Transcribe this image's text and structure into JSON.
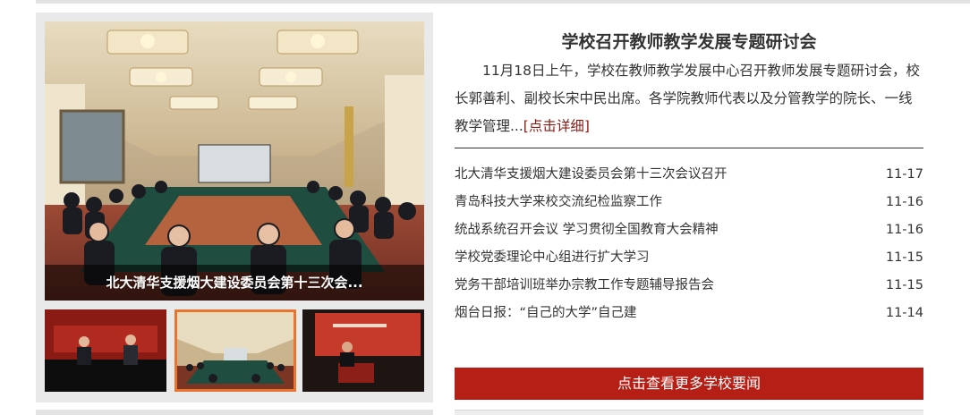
{
  "featured": {
    "caption": "北大清华支援烟大建设委员会第十三次会..."
  },
  "thumbnails": [
    {
      "name": "thumbnail-1",
      "active": false
    },
    {
      "name": "thumbnail-2",
      "active": true
    },
    {
      "name": "thumbnail-3",
      "active": false
    }
  ],
  "headline": {
    "title": "学校召开教师教学发展专题研讨会",
    "summary": "11月18日上午，学校在教师教学发展中心召开教师发展专题研讨会，校长郭善利、副校长宋中民出席。各学院教师代表以及分管教学的院长、一线教学管理...",
    "more_link": "[点击详细]"
  },
  "news": [
    {
      "title": "北大清华支援烟大建设委员会第十三次会议召开",
      "date": "11-17"
    },
    {
      "title": "青岛科技大学来校交流纪检监察工作",
      "date": "11-16"
    },
    {
      "title": "统战系统召开会议 学习贯彻全国教育大会精神",
      "date": "11-16"
    },
    {
      "title": "学校党委理论中心组进行扩大学习",
      "date": "11-15"
    },
    {
      "title": "党务干部培训班举办宗教工作专题辅导报告会",
      "date": "11-15"
    },
    {
      "title": "烟台日报：“自己的大学”自己建",
      "date": "11-14"
    }
  ],
  "more_button": "点击查看更多学校要闻",
  "colors": {
    "accent": "#b51f16",
    "link": "#8b1a14",
    "thumb_border": "#e8742f"
  }
}
